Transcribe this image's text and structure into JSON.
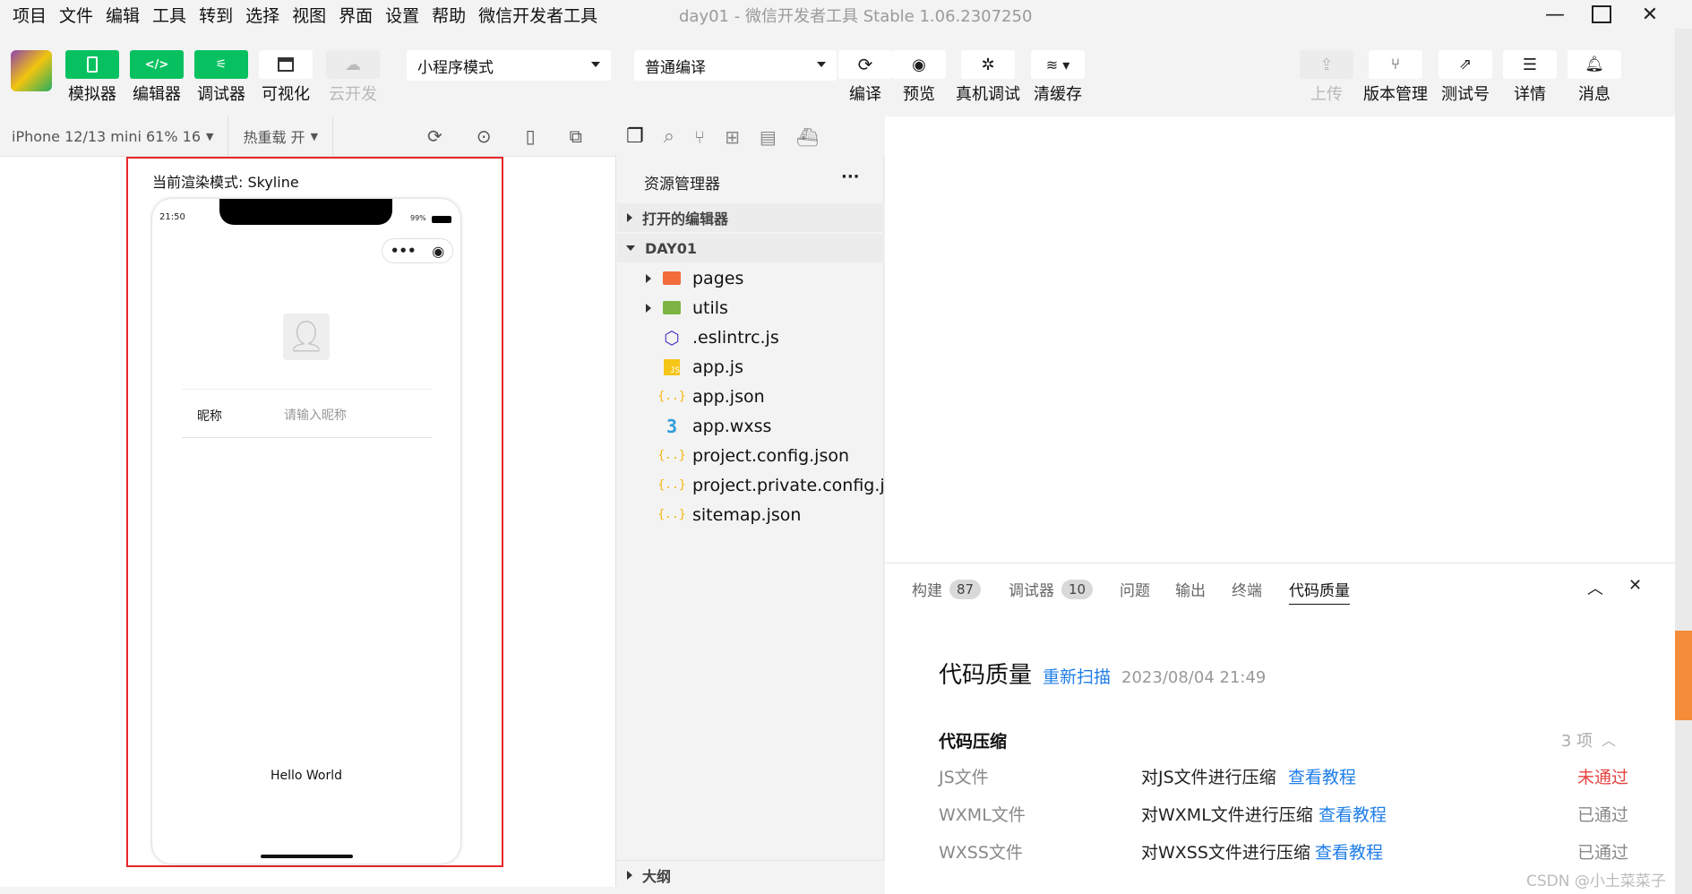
{
  "menu": [
    "项目",
    "文件",
    "编辑",
    "工具",
    "转到",
    "选择",
    "视图",
    "界面",
    "设置",
    "帮助",
    "微信开发者工具"
  ],
  "window": {
    "project": "day01",
    "separator": "-",
    "app": "微信开发者工具 Stable 1.06.2307250"
  },
  "toolbar": {
    "left_buttons": [
      "模拟器",
      "编辑器",
      "调试器",
      "可视化",
      "云开发"
    ],
    "mode": "小程序模式",
    "compile_mode": "普通编译",
    "center_buttons": [
      "编译",
      "预览",
      "真机调试",
      "清缓存"
    ],
    "right_buttons": [
      "上传",
      "版本管理",
      "测试号",
      "详情",
      "消息"
    ]
  },
  "simulator": {
    "device": "iPhone 12/13 mini 61% 16",
    "hot_reload": "热重载 开",
    "render_mode": "当前渲染模式: Skyline",
    "status_time": "21:50",
    "battery": "99%",
    "nickname_label": "昵称",
    "nickname_placeholder": "请输入昵称",
    "hello": "Hello World"
  },
  "explorer": {
    "title": "资源管理器",
    "more": "···",
    "open_editors": "打开的编辑器",
    "project": "DAY01",
    "files": [
      {
        "name": "pages",
        "icon": "folder-icon"
      },
      {
        "name": "utils",
        "icon": "folder-icon"
      },
      {
        "name": ".eslintrc.js",
        "icon": "eslint-icon"
      },
      {
        "name": "app.js",
        "icon": "js-icon"
      },
      {
        "name": "app.json",
        "icon": "json-icon"
      },
      {
        "name": "app.wxss",
        "icon": "css-icon"
      },
      {
        "name": "project.config.json",
        "icon": "json-icon"
      },
      {
        "name": "project.private.config.js...",
        "icon": "json-icon"
      },
      {
        "name": "sitemap.json",
        "icon": "json-icon"
      }
    ],
    "outline": "大纲"
  },
  "panel": {
    "tabs": [
      {
        "label": "构建",
        "badge": "87"
      },
      {
        "label": "调试器",
        "badge": "10"
      },
      {
        "label": "问题",
        "badge": ""
      },
      {
        "label": "输出",
        "badge": ""
      },
      {
        "label": "终端",
        "badge": ""
      },
      {
        "label": "代码质量",
        "badge": ""
      }
    ],
    "title": "代码质量",
    "rescan": "重新扫描",
    "timestamp": "2023/08/04 21:49",
    "section": "代码压缩",
    "count": "3 项",
    "rows": [
      {
        "type": "JS文件",
        "desc": "对JS文件进行压缩",
        "link": "查看教程",
        "status": "未通过",
        "fail": true
      },
      {
        "type": "WXML文件",
        "desc": "对WXML文件进行压缩",
        "link": "查看教程",
        "status": "已通过",
        "fail": false
      },
      {
        "type": "WXSS文件",
        "desc": "对WXSS文件进行压缩",
        "link": "查看教程",
        "status": "已通过",
        "fail": false
      }
    ]
  },
  "watermark": "CSDN @小土菜菜子",
  "colors": {
    "accent_green": "#07c160",
    "link_blue": "#1f7ee8",
    "fail_red": "#e64340",
    "frame_red": "#e6262b"
  }
}
